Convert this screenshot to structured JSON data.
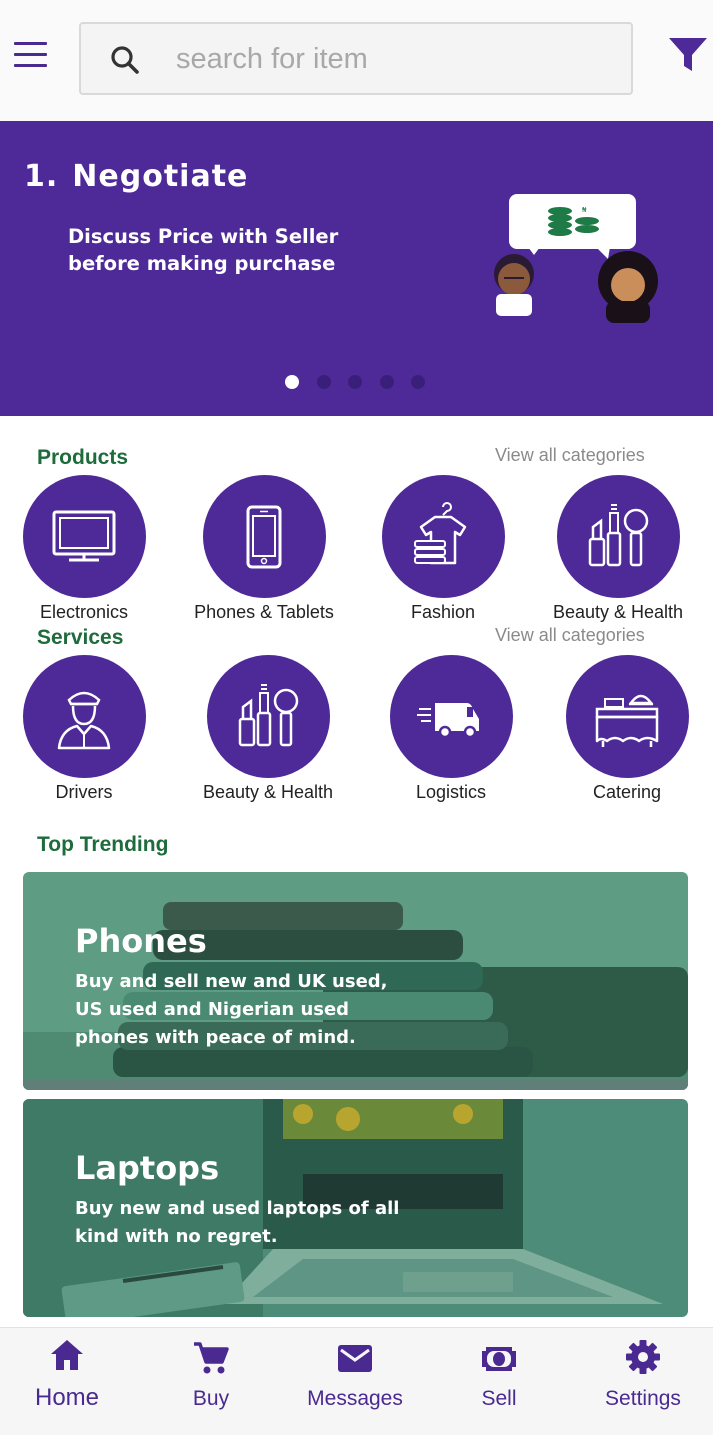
{
  "header": {
    "menu_icon": "hamburger-menu-icon",
    "search": {
      "placeholder": "search for item",
      "value": "",
      "icon": "search-icon"
    },
    "filter_icon": "filter-icon"
  },
  "banner": {
    "number": "1.",
    "title": "Negotiate",
    "subtitle": "Discuss Price with Seller before making purchase",
    "slide_count": 5,
    "active_slide": 1,
    "bg_color": "#4e2a98"
  },
  "products": {
    "title": "Products",
    "view_all": "View all categories",
    "items": [
      {
        "label": "Electronics",
        "icon": "monitor-icon"
      },
      {
        "label": "Phones & Tablets",
        "icon": "smartphone-icon"
      },
      {
        "label": "Fashion",
        "icon": "clothes-icon"
      },
      {
        "label": "Beauty & Health",
        "icon": "cosmetics-icon"
      }
    ]
  },
  "services": {
    "title": "Services",
    "view_all": "View all categories",
    "items": [
      {
        "label": "Drivers",
        "icon": "driver-icon"
      },
      {
        "label": "Beauty & Health",
        "icon": "cosmetics-icon"
      },
      {
        "label": "Logistics",
        "icon": "delivery-truck-icon"
      },
      {
        "label": "Catering",
        "icon": "catering-icon"
      }
    ]
  },
  "trending": {
    "title": "Top Trending",
    "cards": [
      {
        "title": "Phones",
        "description": "Buy and sell new and UK used, US used and Nigerian used phones with peace of mind."
      },
      {
        "title": "Laptops",
        "description": "Buy new and used laptops of all kind with no regret."
      }
    ]
  },
  "bottom_nav": {
    "items": [
      {
        "label": "Home",
        "icon": "home-icon",
        "active": true
      },
      {
        "label": "Buy",
        "icon": "cart-icon",
        "active": false
      },
      {
        "label": "Messages",
        "icon": "mail-icon",
        "active": false
      },
      {
        "label": "Sell",
        "icon": "money-icon",
        "active": false
      },
      {
        "label": "Settings",
        "icon": "gear-icon",
        "active": false
      }
    ]
  },
  "colors": {
    "brand_purple": "#4e2a98",
    "section_green": "#1e6b3c",
    "card_overlay": "#3f9a78"
  }
}
